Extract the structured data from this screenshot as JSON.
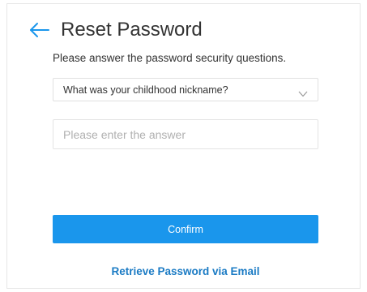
{
  "header": {
    "back_icon": "arrow-left-icon",
    "title": "Reset Password"
  },
  "form": {
    "instruction": "Please answer the password security questions.",
    "question_select": {
      "selected": "What was your childhood nickname?",
      "icon": "chevron-down-icon"
    },
    "answer_input": {
      "value": "",
      "placeholder": "Please enter the answer"
    },
    "confirm_label": "Confirm",
    "retrieve_link_label": "Retrieve Password via Email"
  },
  "colors": {
    "accent": "#1a96ec",
    "link": "#1b7bc4",
    "border": "#e0e0e0",
    "text": "#333333",
    "placeholder": "#b0b0b0"
  }
}
